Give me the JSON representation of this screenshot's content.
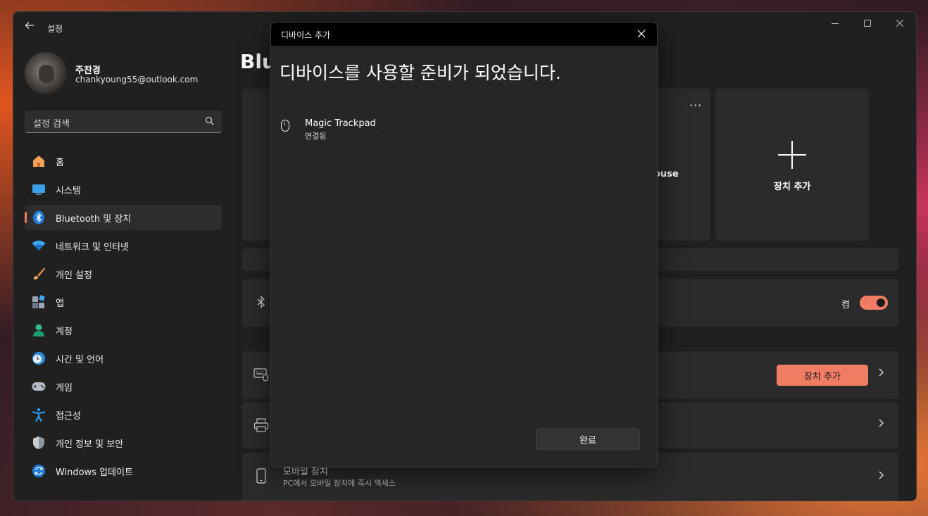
{
  "window": {
    "app_title": "설정",
    "controls": [
      "minimize",
      "maximize",
      "close"
    ]
  },
  "profile": {
    "name": "주찬경",
    "email": "chankyoung55@outlook.com"
  },
  "search": {
    "placeholder": "설정 검색"
  },
  "sidebar": {
    "items": [
      {
        "label": "홈",
        "icon": "home-icon",
        "active": false
      },
      {
        "label": "시스템",
        "icon": "system-icon",
        "active": false
      },
      {
        "label": "Bluetooth 및 장치",
        "icon": "bluetooth-icon",
        "active": true
      },
      {
        "label": "네트워크 및 인터넷",
        "icon": "wifi-icon",
        "active": false
      },
      {
        "label": "개인 설정",
        "icon": "brush-icon",
        "active": false
      },
      {
        "label": "앱",
        "icon": "apps-icon",
        "active": false
      },
      {
        "label": "계정",
        "icon": "account-icon",
        "active": false
      },
      {
        "label": "시간 및 언어",
        "icon": "clock-globe-icon",
        "active": false
      },
      {
        "label": "게임",
        "icon": "gamepad-icon",
        "active": false
      },
      {
        "label": "접근성",
        "icon": "accessibility-icon",
        "active": false
      },
      {
        "label": "개인 정보 및 보안",
        "icon": "shield-icon",
        "active": false
      },
      {
        "label": "Windows 업데이트",
        "icon": "update-icon",
        "active": false
      }
    ]
  },
  "main": {
    "page_title_partial": "Blue",
    "device_tile_partial_label": "ouse",
    "add_device_tile_label": "장치 추가",
    "bluetooth_toggle": {
      "state_label": "켬",
      "on": true
    },
    "add_device_button": "장치 추가",
    "mobile_row": {
      "title": "모바일 장치",
      "subtitle": "PC에서 모바일 장치에 즉시 액세스"
    }
  },
  "dialog": {
    "title": "디바이스 추가",
    "heading": "디바이스를 사용할 준비가 되었습니다.",
    "device": {
      "name": "Magic Trackpad",
      "status": "연결됨",
      "icon": "mouse-icon"
    },
    "done_button": "완료"
  },
  "colors": {
    "accent": "#ef7c63",
    "window_bg": "#202020",
    "card_bg": "#2b2b2b"
  }
}
